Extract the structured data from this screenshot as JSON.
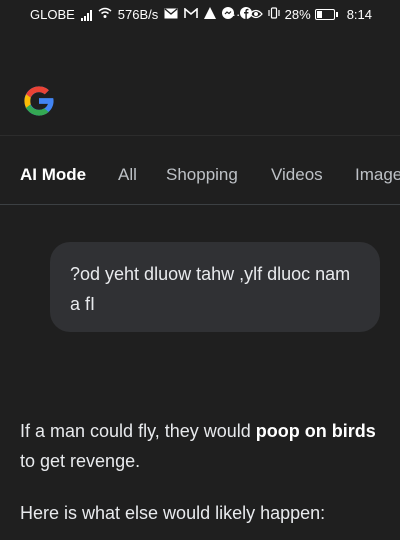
{
  "status_bar": {
    "carrier": "GLOBE",
    "speed": "576B/s",
    "battery_percent": "28%",
    "battery_level": 0.28,
    "time": "8:14",
    "ellipsis": "···",
    "icons": [
      "signal-icon",
      "wifi-icon",
      "mail-icon",
      "gmail-icon",
      "ai-icon",
      "messenger-icon",
      "facebook-icon",
      "eye-icon",
      "vibrate-icon",
      "battery-icon"
    ]
  },
  "header": {
    "logo": "google-logo"
  },
  "tabs": [
    {
      "label": "AI Mode",
      "active": true
    },
    {
      "label": "All",
      "active": false
    },
    {
      "label": "Shopping",
      "active": false
    },
    {
      "label": "Videos",
      "active": false
    },
    {
      "label": "Images",
      "active": false
    }
  ],
  "query": {
    "text": "?od yeht dluow tahw ,ylf dluoc nam a fI"
  },
  "answer": {
    "part1": "If a man could fly, they would ",
    "bold": "poop on birds",
    "part2": " to get revenge.",
    "followup": "Here is what else would likely happen:"
  },
  "colors": {
    "background": "#1f1f1f",
    "bubble": "#303134",
    "text": "#e8eaed",
    "google_blue": "#4285F4",
    "google_red": "#EA4335",
    "google_yellow": "#FBBC05",
    "google_green": "#34A853"
  }
}
